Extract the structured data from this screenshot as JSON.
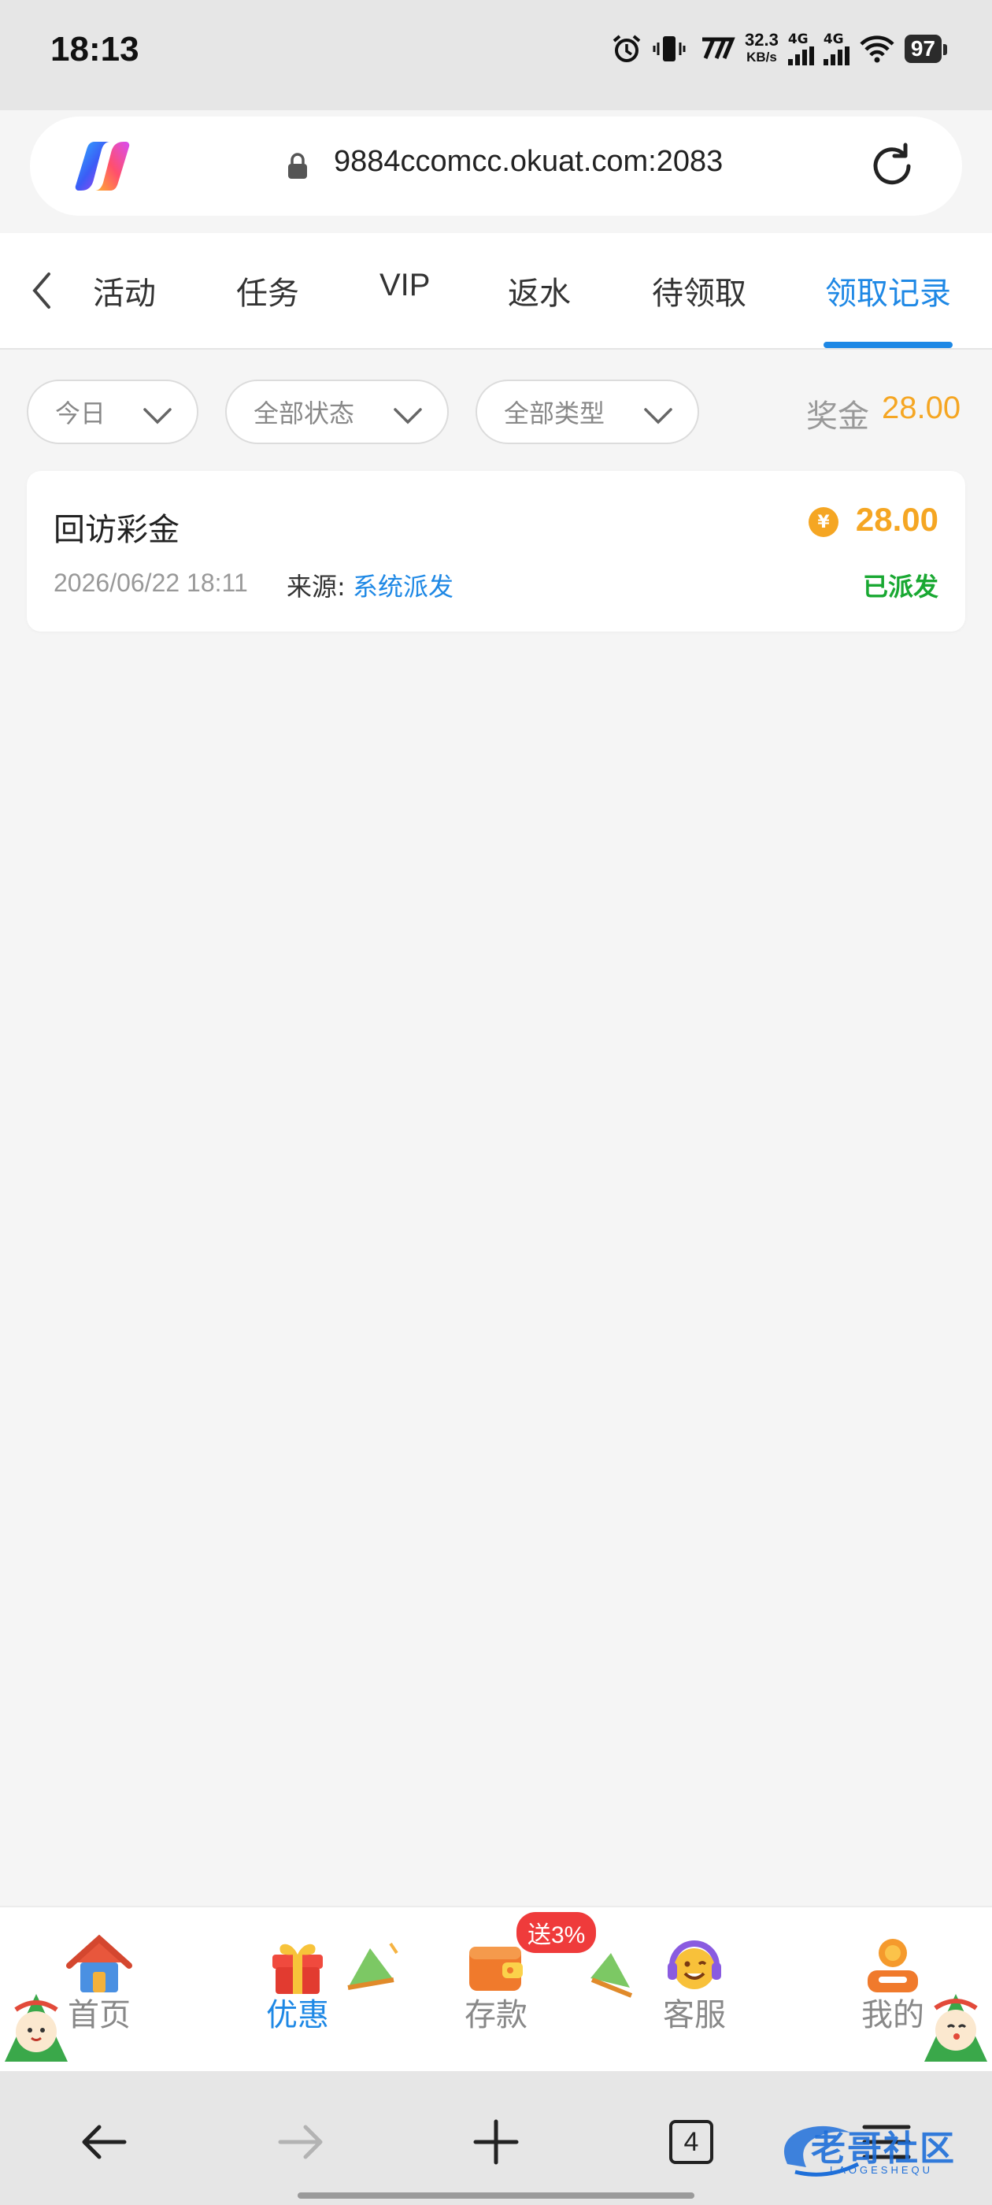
{
  "status_bar": {
    "time": "18:13",
    "net_speed": "32.3",
    "net_speed_unit": "KB/s",
    "signal_1": "4G",
    "signal_2": "4G",
    "battery": "97",
    "icons": [
      "alarm-icon",
      "vibrate-icon",
      "hd-icon",
      "signal-icon",
      "wifi-icon",
      "battery-icon"
    ]
  },
  "browser": {
    "url": "9884ccomcc.okuat.com:2083",
    "tab_count": "4"
  },
  "tabs": [
    {
      "label": "活动",
      "active": false
    },
    {
      "label": "任务",
      "active": false
    },
    {
      "label": "VIP",
      "active": false
    },
    {
      "label": "返水",
      "active": false
    },
    {
      "label": "待领取",
      "active": false
    },
    {
      "label": "领取记录",
      "active": true
    }
  ],
  "filters": {
    "date": "今日",
    "status": "全部状态",
    "type": "全部类型"
  },
  "bonus_total": {
    "label": "奖金",
    "value": "28.00"
  },
  "records": [
    {
      "title": "回访彩金",
      "date": "2026/06/22 18:11",
      "source_label": "来源:",
      "source_value": "系统派发",
      "coin_symbol": "¥",
      "amount": "28.00",
      "status": "已派发"
    }
  ],
  "bottom_nav": [
    {
      "label": "首页",
      "icon": "house-icon",
      "active": false
    },
    {
      "label": "优惠",
      "icon": "gift-icon",
      "active": true
    },
    {
      "label": "存款",
      "icon": "wallet-icon",
      "active": false,
      "badge": "送3%"
    },
    {
      "label": "客服",
      "icon": "headset-icon",
      "active": false
    },
    {
      "label": "我的",
      "icon": "profile-icon",
      "active": false
    }
  ],
  "watermark": {
    "text": "老哥社区",
    "sub": "LAOGESHEQU"
  },
  "colors": {
    "accent": "#1e88e5",
    "amount": "#f5a623",
    "status_ok": "#19a832",
    "badge": "#ef3b3b"
  }
}
